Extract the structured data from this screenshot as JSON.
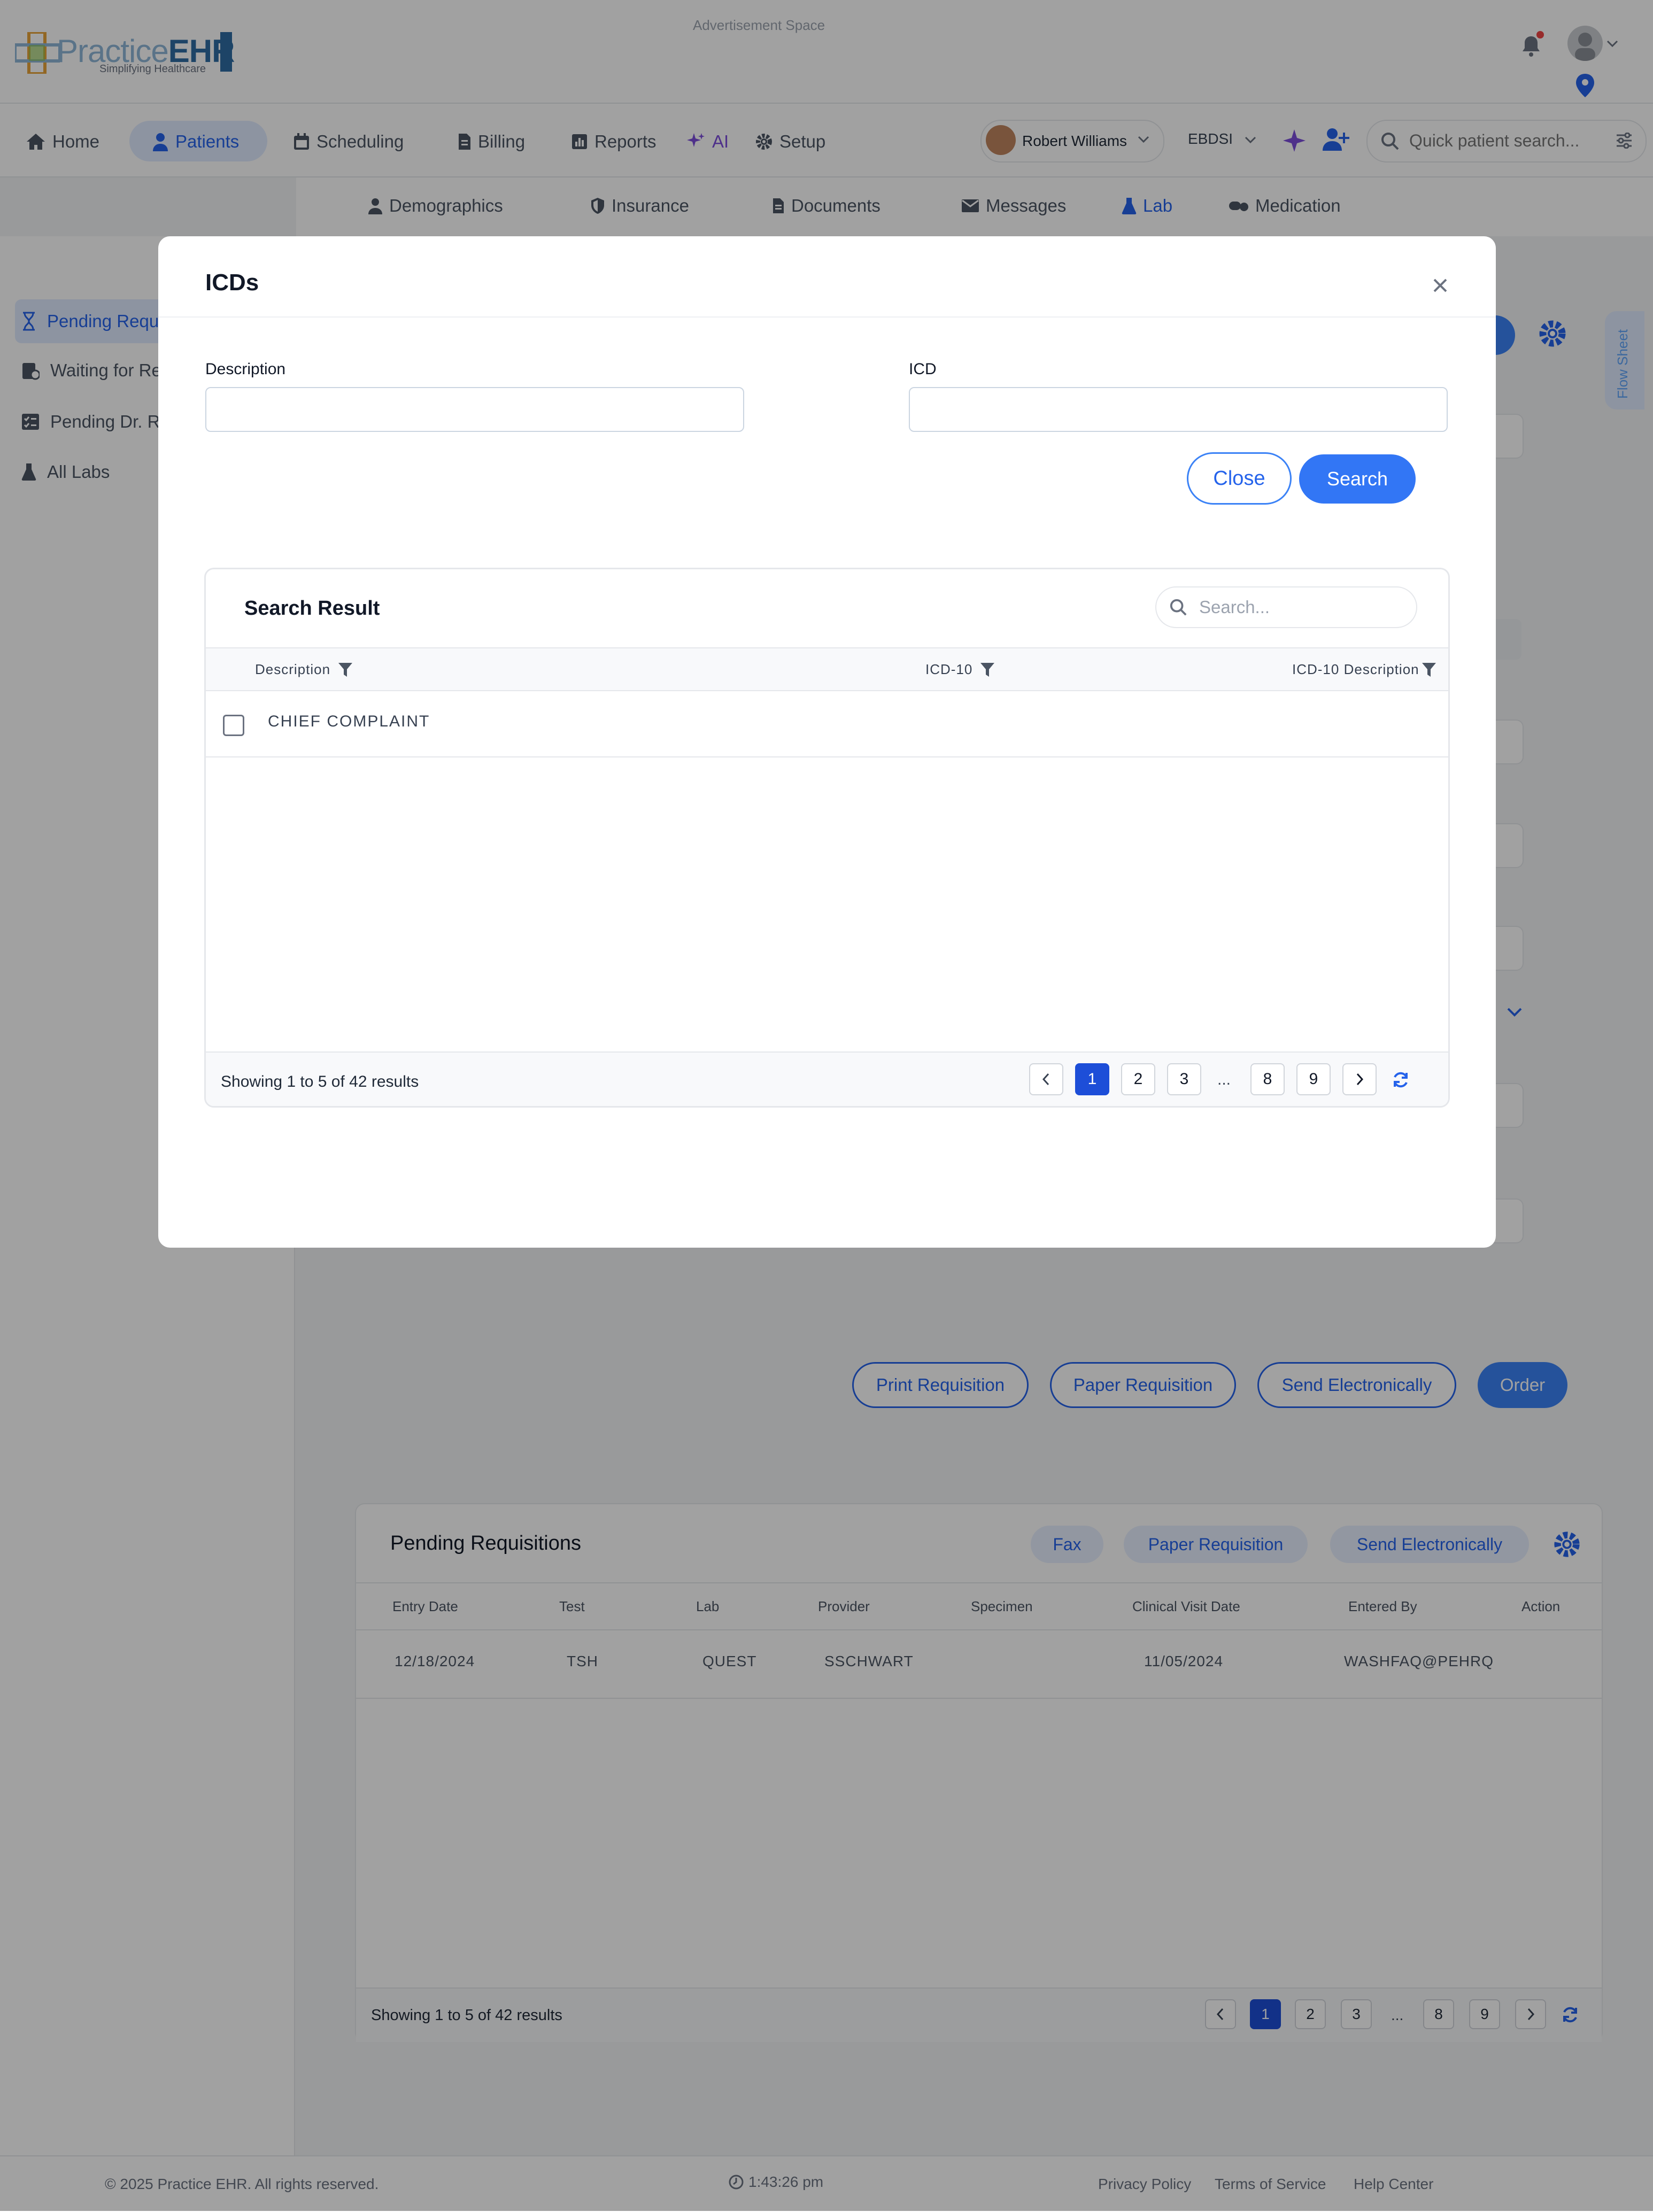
{
  "brand": {
    "name_part1": "Practice",
    "name_part2": "EHR",
    "tagline": "Simplifying Healthcare"
  },
  "header": {
    "ad_text": "Advertisement Space"
  },
  "nav": {
    "items": [
      {
        "label": "Home",
        "icon": "home-icon"
      },
      {
        "label": "Patients",
        "icon": "user-icon",
        "active": true
      },
      {
        "label": "Scheduling",
        "icon": "calendar-icon"
      },
      {
        "label": "Billing",
        "icon": "document-icon"
      },
      {
        "label": "Reports",
        "icon": "chart-icon"
      },
      {
        "label": "AI",
        "icon": "sparkle-icon"
      },
      {
        "label": "Setup",
        "icon": "gear-icon"
      }
    ],
    "provider": "Robert Williams",
    "facility": "EBDSI",
    "quick_search_placeholder": "Quick patient search..."
  },
  "subtabs": [
    "Demographics",
    "Insurance",
    "Documents",
    "Messages",
    "Lab",
    "Medication"
  ],
  "sidebar": {
    "items": [
      {
        "label": "Pending Requisitions",
        "icon": "hourglass-icon",
        "active": true
      },
      {
        "label": "Waiting for Results",
        "icon": "clipboard-clock-icon"
      },
      {
        "label": "Pending Dr. Review",
        "icon": "checklist-icon"
      },
      {
        "label": "All Labs",
        "icon": "flask-icon"
      }
    ]
  },
  "flow_sheet": {
    "label": "Flow Sheet"
  },
  "requisition_actions": {
    "print": "Print Requisition",
    "paper": "Paper Requisition",
    "send": "Send Electronically",
    "order": "Order"
  },
  "pending": {
    "title": "Pending Requisitions",
    "actions": {
      "fax": "Fax",
      "paper": "Paper Requisition",
      "send": "Send Electronically"
    },
    "columns": [
      "Entry Date",
      "Test",
      "Lab",
      "Provider",
      "Specimen",
      "Clinical Visit Date",
      "Entered By",
      "Action"
    ],
    "row": {
      "entry_date": "12/18/2024",
      "test": "TSH",
      "lab": "QUEST",
      "provider": "SSCHWART",
      "specimen": "",
      "visit_date": "11/05/2024",
      "entered_by": "WASHFAQ@PEHRQ",
      "action": ""
    },
    "showing": "Showing 1 to 5 of 42 results",
    "pages": [
      "1",
      "2",
      "3",
      "...",
      "8",
      "9"
    ]
  },
  "footer": {
    "copyright": "© 2025 Practice EHR. All rights reserved.",
    "time": "1:43:26 pm",
    "links": [
      "Privacy Policy",
      "Terms of Service",
      "Help Center"
    ]
  },
  "modal": {
    "title": "ICDs",
    "description_label": "Description",
    "description_value": "",
    "icd_label": "ICD",
    "icd_value": "",
    "close_label": "Close",
    "search_label": "Search",
    "results": {
      "title": "Search Result",
      "search_placeholder": "Search...",
      "columns": [
        "Description",
        "ICD-10",
        "ICD-10 Description"
      ],
      "rows": [
        {
          "description": "CHIEF COMPLAINT",
          "icd10": "",
          "icd10_description": ""
        }
      ],
      "showing": "Showing 1 to 5 of 42 results",
      "pages": [
        "1",
        "2",
        "3",
        "...",
        "8",
        "9"
      ],
      "current_page": "1"
    }
  },
  "colors": {
    "accent": "#2563eb",
    "active_bg": "#e0ebff",
    "overlay": "rgba(0,0,0,0.37)"
  }
}
